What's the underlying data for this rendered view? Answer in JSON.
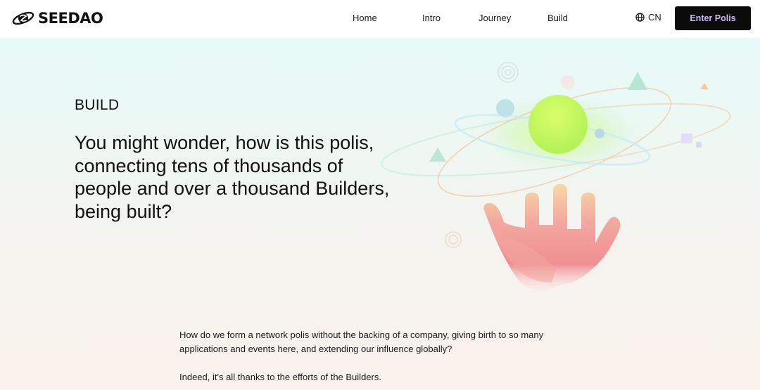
{
  "brand": {
    "name": "SEEDAO"
  },
  "nav": {
    "items": [
      {
        "label": "Home"
      },
      {
        "label": "Intro"
      },
      {
        "label": "Journey"
      },
      {
        "label": "Build"
      }
    ],
    "language": {
      "label": "CN",
      "icon": "globe-icon"
    },
    "cta": {
      "label": "Enter Polis"
    }
  },
  "hero": {
    "section_label": "BUILD",
    "headline": "You might wonder, how is this polis, connecting tens of thousands of people and over a thousand Builders, being built?",
    "illustration": "hand-holding-planet"
  },
  "body": {
    "paragraph_1": "How do we form a network polis without the backing of a company, giving birth to so many applications and events here, and extending our influence globally?",
    "paragraph_2": "Indeed, it's all thanks to the efforts of the Builders."
  }
}
